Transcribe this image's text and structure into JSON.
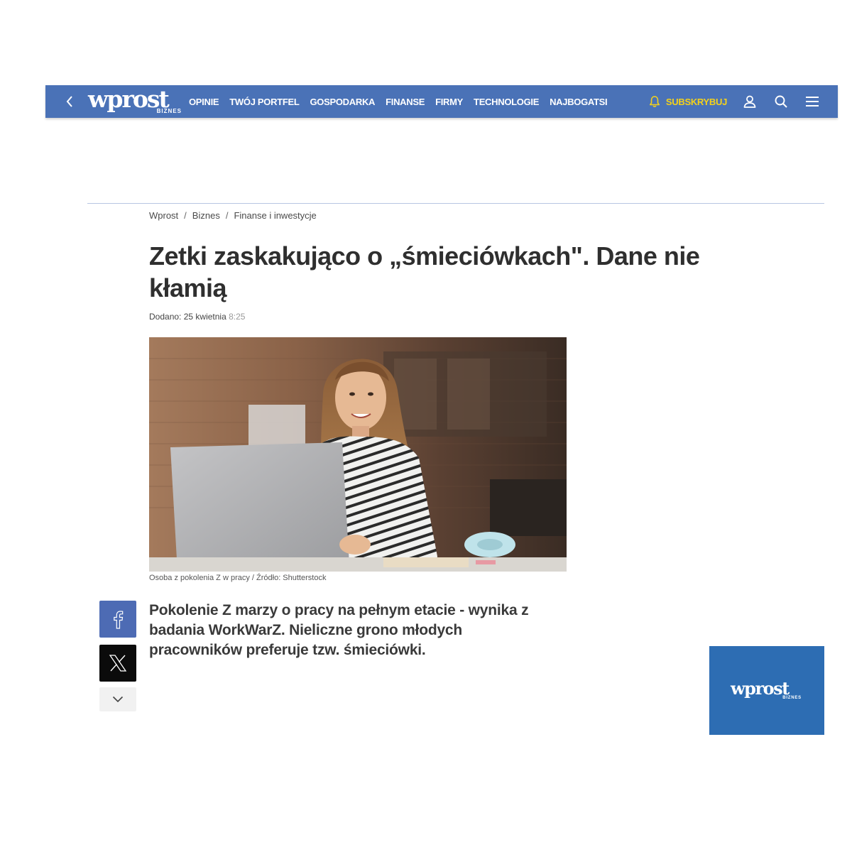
{
  "header": {
    "logo_text": "wprost",
    "logo_subtext": "BIZNES",
    "nav_items": [
      "OPINIE",
      "TWÓJ PORTFEL",
      "GOSPODARKA",
      "FINANSE",
      "FIRMY",
      "TECHNOLOGIE",
      "NAJBOGATSI"
    ],
    "subscribe_label": "SUBSKRYBUJ",
    "background_color": "#4a72b7",
    "subscribe_color": "#f5d21a",
    "icons": [
      "chevron-left-icon",
      "bell-icon",
      "user-icon",
      "search-icon",
      "menu-icon"
    ]
  },
  "breadcrumb": {
    "items": [
      "Wprost",
      "Biznes",
      "Finanse i inwestycje"
    ],
    "separator": "/"
  },
  "article": {
    "title": "Zetki zaskakująco o „śmieciówkach\". Dane nie kłamią",
    "date_prefix": "Dodano:",
    "date": "25 kwietnia",
    "time": "8:25",
    "image_caption": "Osoba z pokolenia Z w pracy / Źródło: Shutterstock",
    "lead": "Pokolenie Z marzy o pracy na pełnym etacie - wynika z badania WorkWarZ. Nieliczne grono młodych pracowników preferuje tzw. śmieciówki."
  },
  "share": {
    "facebook_color": "#4d6bb4",
    "x_color": "#0b0b0b",
    "icons": [
      "facebook-icon",
      "x-icon",
      "chevron-down-icon"
    ]
  },
  "side_ad": {
    "logo_text": "wprost",
    "logo_subtext": "BIZNES",
    "background_color": "#2d6db3"
  }
}
